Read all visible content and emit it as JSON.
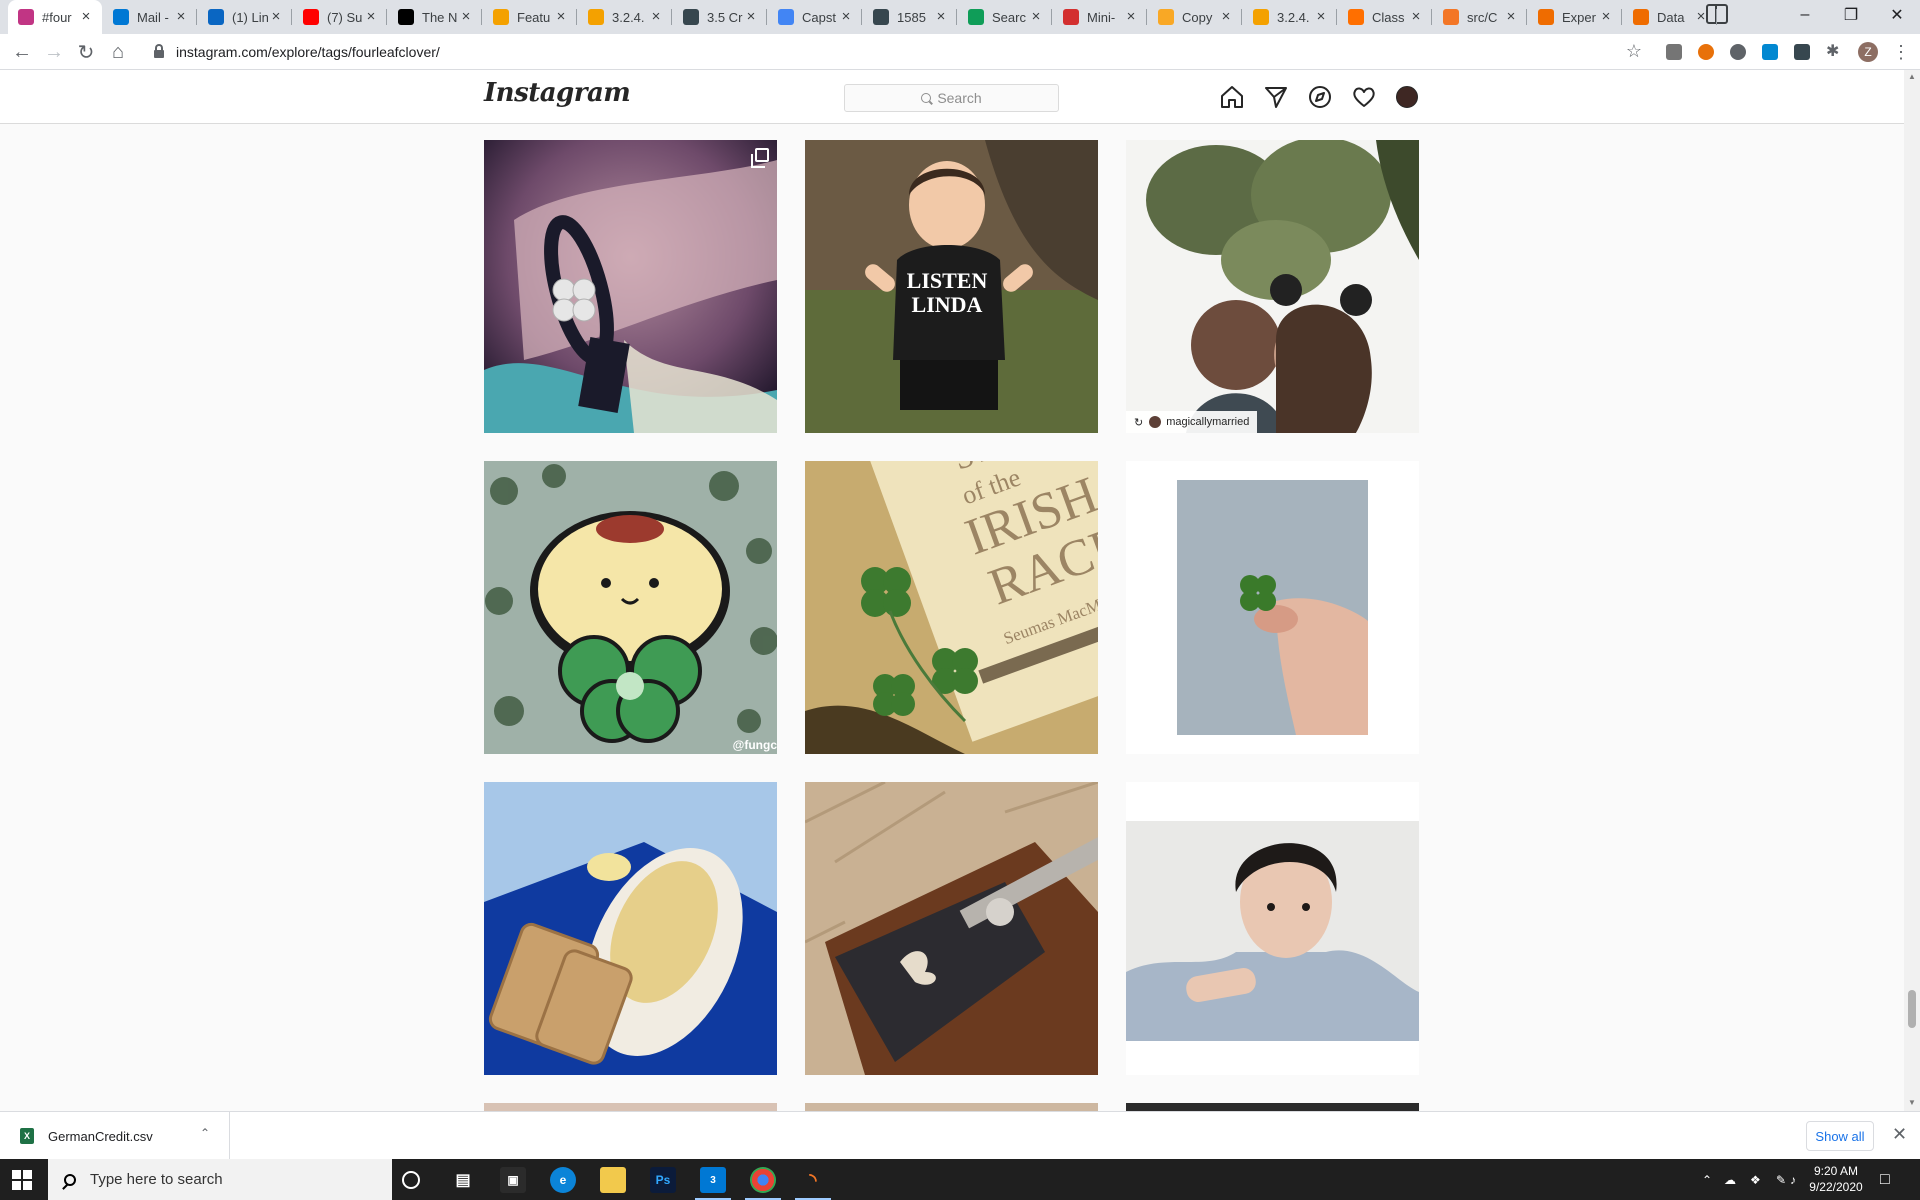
{
  "browser": {
    "tabs": [
      {
        "title": "#four",
        "icon": "instagram-icon",
        "color": "#c13584",
        "active": true
      },
      {
        "title": "Mail -",
        "icon": "outlook-icon",
        "color": "#0078d4"
      },
      {
        "title": "(1) Lin",
        "icon": "linkedin-icon",
        "color": "#0a66c2"
      },
      {
        "title": "(7) Su",
        "icon": "youtube-icon",
        "color": "#ff0000"
      },
      {
        "title": "The N",
        "icon": "nytimes-icon",
        "color": "#000000"
      },
      {
        "title": "Featu",
        "icon": "chart-icon",
        "color": "#f4a100"
      },
      {
        "title": "3.2.4.",
        "icon": "chart-icon",
        "color": "#f4a100"
      },
      {
        "title": "3.5 Cr",
        "icon": "book-icon",
        "color": "#37474f"
      },
      {
        "title": "Capst",
        "icon": "docs-icon",
        "color": "#4285f4"
      },
      {
        "title": "1585",
        "icon": "book-icon",
        "color": "#37474f"
      },
      {
        "title": "Searc",
        "icon": "drive-icon",
        "color": "#0f9d58"
      },
      {
        "title": "Mini-",
        "icon": "infinity-icon",
        "color": "#d32f2f"
      },
      {
        "title": "Copy",
        "icon": "infinity-icon",
        "color": "#f9a825"
      },
      {
        "title": "3.2.4.",
        "icon": "chart-icon",
        "color": "#f4a100"
      },
      {
        "title": "Class",
        "icon": "kaggle-icon",
        "color": "#ff6f00"
      },
      {
        "title": "src/C",
        "icon": "jupyter-icon",
        "color": "#f37626"
      },
      {
        "title": "Exper",
        "icon": "book-icon",
        "color": "#ef6c00"
      },
      {
        "title": "Data",
        "icon": "book-icon",
        "color": "#ef6c00"
      }
    ],
    "url": "instagram.com/explore/tags/fourleafclover/",
    "profile_initial": "Z"
  },
  "instagram": {
    "logo": "Instagram",
    "search_placeholder": "Search",
    "posts": [
      {
        "alt": "bracelet with four-leaf clover charm",
        "multi": true
      },
      {
        "alt": "child in Listen Linda t-shirt",
        "shirt_text_1": "LISTEN",
        "shirt_text_2": "LINDA"
      },
      {
        "alt": "couple kissing under clover leaves",
        "repost_user": "magicallymarried"
      },
      {
        "alt": "puppy character holding clover",
        "watermark": "@fungc"
      },
      {
        "alt": "Story of the Irish Race book with clovers",
        "book_line_1": "STORY",
        "book_line_2": "of the",
        "book_line_3": "IRISH",
        "book_line_4": "RACE",
        "book_author": "Seumas MacManus"
      },
      {
        "alt": "hand holding four-leaf clover"
      },
      {
        "alt": "bread and casserole on blue plate"
      },
      {
        "alt": "engraved shotgun with clover"
      },
      {
        "alt": "portrait of young man"
      }
    ]
  },
  "downloads": {
    "file": "GermanCredit.csv",
    "show_all": "Show all"
  },
  "taskbar": {
    "search_placeholder": "Type here to search",
    "time": "9:20 AM",
    "date": "9/22/2020",
    "mail_badge": "3"
  }
}
